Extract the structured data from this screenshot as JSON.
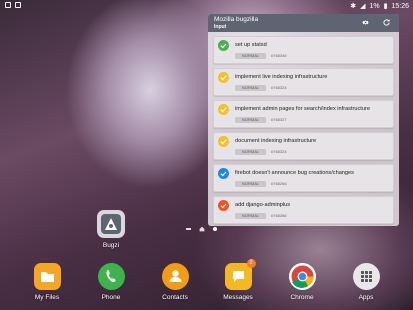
{
  "status_bar": {
    "battery": "1%",
    "time": "15:26"
  },
  "widget": {
    "title": "Mozilla bugzilla",
    "subtitle": "Input",
    "bugs": [
      {
        "title": "set up statsd",
        "badge": "NORMAL",
        "id": "#765346",
        "color": "#4caf50"
      },
      {
        "title": "implement live indexing infrastructure",
        "badge": "NORMAL",
        "id": "#765324",
        "color": "#f5c12a"
      },
      {
        "title": "implement admin pages for search/index infrastructure",
        "badge": "NORMAL",
        "id": "#765327",
        "color": "#f5c12a"
      },
      {
        "title": "document indexing infrastructure",
        "badge": "NORMAL",
        "id": "#765324",
        "color": "#f5c12a"
      },
      {
        "title": "firebot doesn't announce bug creations/changes",
        "badge": "NORMAL",
        "id": "#765266",
        "color": "#1e88e5"
      },
      {
        "title": "add django-adminplus",
        "badge": "NORMAL",
        "id": "#765286",
        "color": "#f4511e"
      }
    ]
  },
  "home": {
    "bugzi_label": "Bugzi"
  },
  "dock": {
    "items": [
      {
        "label": "My Files",
        "color": "#f5a623"
      },
      {
        "label": "Phone",
        "color": "#3cb44b"
      },
      {
        "label": "Contacts",
        "color": "#f39c12"
      },
      {
        "label": "Messages",
        "color": "#f5b820",
        "badge": "2"
      },
      {
        "label": "Chrome",
        "color": "#ffffff"
      },
      {
        "label": "Apps",
        "color": "#e8e8ea"
      }
    ]
  }
}
